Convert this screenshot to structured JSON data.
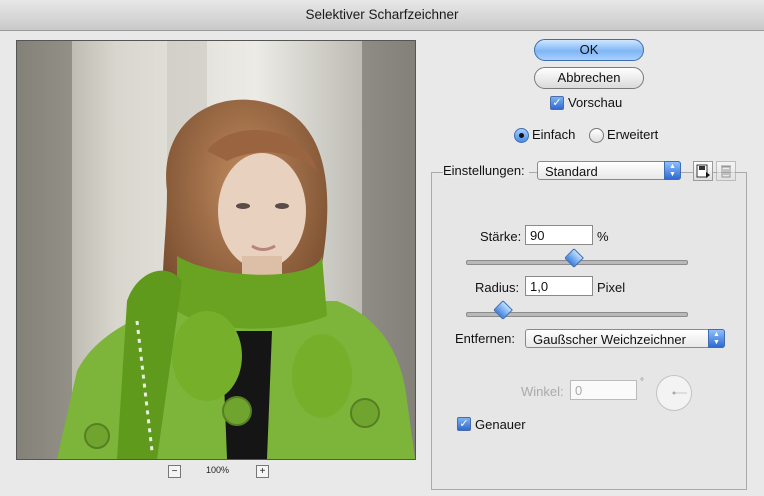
{
  "window": {
    "title": "Selektiver Scharfzeichner"
  },
  "preview": {
    "zoom": "100%",
    "zoom_out": "−",
    "zoom_in": "+"
  },
  "buttons": {
    "ok": "OK",
    "cancel": "Abbrechen"
  },
  "preview_check": {
    "label": "Vorschau",
    "checked": true
  },
  "mode": {
    "simple": "Einfach",
    "advanced": "Erweitert",
    "selected": "Einfach"
  },
  "settings": {
    "label": "Einstellungen:",
    "value": "Standard"
  },
  "amount": {
    "label": "Stärke:",
    "value": "90",
    "unit": "%",
    "slider_fraction": 0.49
  },
  "radius": {
    "label": "Radius:",
    "value": "1,0",
    "unit": "Pixel",
    "slider_fraction": 0.17
  },
  "remove": {
    "label": "Entfernen:",
    "value": "Gaußscher Weichzeichner"
  },
  "angle": {
    "label": "Winkel:",
    "value": "0",
    "unit": "°"
  },
  "more_accurate": {
    "label": "Genauer",
    "checked": true
  },
  "colors": {
    "accent": "#3f80dd",
    "scarf": "#6aa321",
    "jacket": "#7db53a"
  }
}
